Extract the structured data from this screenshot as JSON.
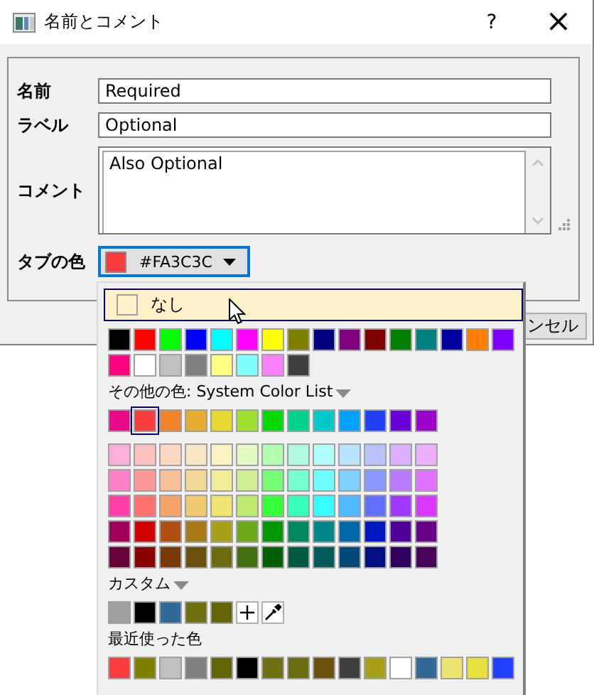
{
  "window": {
    "title": "名前とコメント",
    "help": "?",
    "close": "×"
  },
  "fields": [
    {
      "kind": "text",
      "label": "名前",
      "value": "Required"
    },
    {
      "kind": "text",
      "label": "ラベル",
      "value": "Optional"
    },
    {
      "kind": "textarea",
      "label": "コメント",
      "value": "Also Optional"
    },
    {
      "kind": "color",
      "label": "タブの色",
      "value": "#FA3C3C",
      "color": "#fa3c3c",
      "focused": true
    }
  ],
  "buttons": [
    {
      "label": "ンセル"
    }
  ],
  "popup": {
    "none_option": {
      "label": "なし",
      "hovered": true
    },
    "sections": [
      {
        "kind": "swatches",
        "rows": [
          [
            {
              "color": "#000000"
            },
            {
              "color": "#ff0000"
            },
            {
              "color": "#00ff00"
            },
            {
              "color": "#0000ff"
            },
            {
              "color": "#00ffff"
            },
            {
              "color": "#ff00ff"
            },
            {
              "color": "#ffff00"
            },
            {
              "color": "#808000"
            },
            {
              "color": "#000080"
            },
            {
              "color": "#800080"
            },
            {
              "color": "#800000"
            },
            {
              "color": "#008000"
            },
            {
              "color": "#008080"
            },
            {
              "color": "#0000a0"
            },
            {
              "color": "#ff8000"
            },
            {
              "color": "#8000ff"
            }
          ],
          [
            {
              "color": "#ff0080"
            },
            {
              "color": "#ffffff"
            },
            {
              "color": "#c0c0c0"
            },
            {
              "color": "#808080"
            },
            {
              "color": "#ffff80"
            },
            {
              "color": "#80ffff"
            },
            {
              "color": "#ff80ff"
            },
            {
              "color": "#404040"
            }
          ]
        ]
      },
      {
        "kind": "heading",
        "label": "その他の色: System Color List",
        "dropdown": true
      },
      {
        "kind": "swatches",
        "rows": [
          [
            {
              "color": "#e8088a",
              "selected": false
            },
            {
              "color": "#fa3c3c",
              "selected": true
            },
            {
              "color": "#f0822a",
              "selected": false
            },
            {
              "color": "#e6ae30",
              "selected": false
            },
            {
              "color": "#e6d830",
              "selected": false
            },
            {
              "color": "#a0e030",
              "selected": false
            },
            {
              "color": "#00d800",
              "selected": false
            },
            {
              "color": "#00d088",
              "selected": false
            },
            {
              "color": "#00c8c8",
              "selected": false
            },
            {
              "color": "#00a0ff",
              "selected": false
            },
            {
              "color": "#2040ff",
              "selected": false
            },
            {
              "color": "#6a00d8",
              "selected": false
            },
            {
              "color": "#9a00c8",
              "selected": false
            }
          ]
        ]
      },
      {
        "kind": "spacer"
      },
      {
        "kind": "swatches",
        "rows": [
          [
            {
              "color": "#ffb0d8"
            },
            {
              "color": "#ffc0c0"
            },
            {
              "color": "#fcd8c0"
            },
            {
              "color": "#f8e6c4"
            },
            {
              "color": "#f8f4c4"
            },
            {
              "color": "#e4f8c4"
            },
            {
              "color": "#b0ffb0"
            },
            {
              "color": "#b0f8e0"
            },
            {
              "color": "#b0ffff"
            },
            {
              "color": "#b8e4ff"
            },
            {
              "color": "#b8c4ff"
            },
            {
              "color": "#d8b0ff"
            },
            {
              "color": "#ecb0ff"
            }
          ],
          [
            {
              "color": "#ff80c8"
            },
            {
              "color": "#ff9898"
            },
            {
              "color": "#f8c098"
            },
            {
              "color": "#f4d898"
            },
            {
              "color": "#f0ec98"
            },
            {
              "color": "#d0f098"
            },
            {
              "color": "#78ff78"
            },
            {
              "color": "#78ffd0"
            },
            {
              "color": "#70ffff"
            },
            {
              "color": "#80d0ff"
            },
            {
              "color": "#8898ff"
            },
            {
              "color": "#b878ff"
            },
            {
              "color": "#e070ff"
            }
          ],
          [
            {
              "color": "#ff40a8"
            },
            {
              "color": "#ff7070"
            },
            {
              "color": "#f4a468"
            },
            {
              "color": "#f0c870"
            },
            {
              "color": "#f0e470"
            },
            {
              "color": "#bcea70"
            },
            {
              "color": "#38ff38"
            },
            {
              "color": "#38ffbc"
            },
            {
              "color": "#38ffff"
            },
            {
              "color": "#50b8ff"
            },
            {
              "color": "#6070ff"
            },
            {
              "color": "#a038ff"
            },
            {
              "color": "#d838ff"
            }
          ],
          [
            {
              "color": "#a00058"
            },
            {
              "color": "#d00000"
            },
            {
              "color": "#b05010"
            },
            {
              "color": "#a87814"
            },
            {
              "color": "#a8a018"
            },
            {
              "color": "#6ca818"
            },
            {
              "color": "#009800"
            },
            {
              "color": "#008860"
            },
            {
              "color": "#008888"
            },
            {
              "color": "#0068a8"
            },
            {
              "color": "#0018c0"
            },
            {
              "color": "#500098"
            },
            {
              "color": "#680088"
            }
          ],
          [
            {
              "color": "#680038"
            },
            {
              "color": "#880000"
            },
            {
              "color": "#783808"
            },
            {
              "color": "#6c5010"
            },
            {
              "color": "#6c6c10"
            },
            {
              "color": "#447010"
            },
            {
              "color": "#006000"
            },
            {
              "color": "#005c40"
            },
            {
              "color": "#005c5c"
            },
            {
              "color": "#004878"
            },
            {
              "color": "#001080"
            },
            {
              "color": "#300060"
            },
            {
              "color": "#480058"
            }
          ]
        ]
      },
      {
        "kind": "heading",
        "label": "カスタム",
        "dropdown": true
      },
      {
        "kind": "swatches",
        "rows": [
          [
            {
              "kind": "color",
              "color": "#a0a0a0"
            },
            {
              "kind": "color",
              "color": "#000000"
            },
            {
              "kind": "color",
              "color": "#306898"
            },
            {
              "kind": "color",
              "color": "#707010"
            },
            {
              "kind": "color",
              "color": "#646408"
            },
            {
              "kind": "add"
            },
            {
              "kind": "eyedropper"
            }
          ]
        ]
      },
      {
        "kind": "heading",
        "label": "最近使った色",
        "dropdown": false
      },
      {
        "kind": "swatches",
        "rows": [
          [
            {
              "color": "#fa3c3c"
            },
            {
              "color": "#808000"
            },
            {
              "color": "#c0c0c0"
            },
            {
              "color": "#808080"
            },
            {
              "color": "#646408"
            },
            {
              "color": "#000000"
            },
            {
              "color": "#707010"
            },
            {
              "color": "#6c6c10"
            },
            {
              "color": "#6c5010"
            },
            {
              "color": "#404040"
            },
            {
              "color": "#a8a018"
            },
            {
              "color": "#ffffff"
            },
            {
              "color": "#306898"
            },
            {
              "color": "#f0e470"
            },
            {
              "color": "#e8e040"
            },
            {
              "color": "#2040ff"
            }
          ]
        ]
      }
    ]
  }
}
